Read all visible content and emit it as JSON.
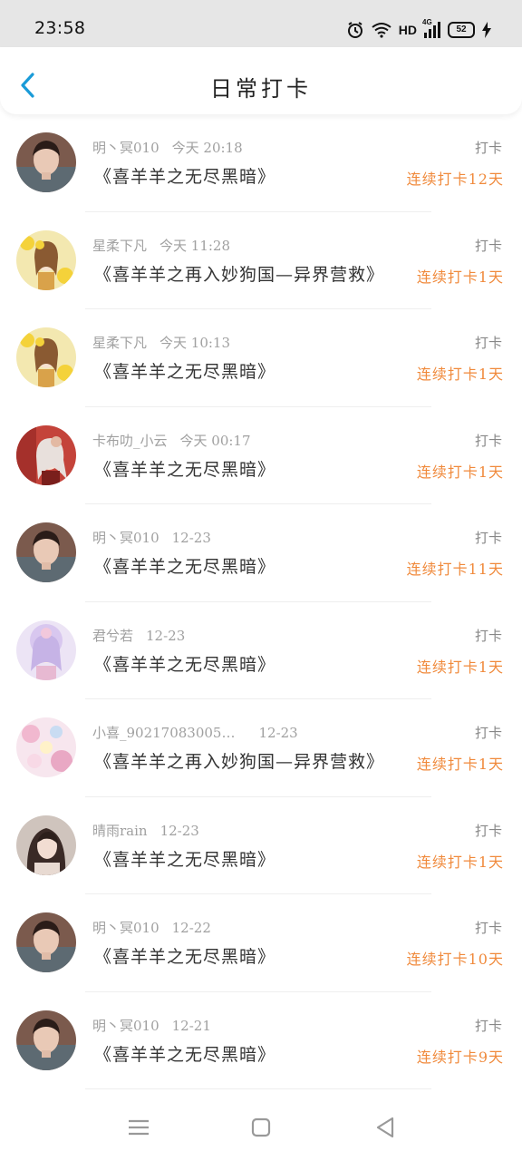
{
  "status_bar": {
    "time": "23:58",
    "network": "HD",
    "signal": "4G",
    "battery": "52"
  },
  "header": {
    "title": "日常打卡"
  },
  "items": [
    {
      "user": "明丶冥010",
      "time": "今天 20:18",
      "book": "《喜羊羊之无尽黑暗》",
      "action": "打卡",
      "streak": "连续打卡12天",
      "avatar": "boy"
    },
    {
      "user": "星柔下凡",
      "time": "今天 11:28",
      "book": "《喜羊羊之再入妙狗国—异界营救》",
      "action": "打卡",
      "streak": "连续打卡1天",
      "avatar": "flower-girl"
    },
    {
      "user": "星柔下凡",
      "time": "今天 10:13",
      "book": "《喜羊羊之无尽黑暗》",
      "action": "打卡",
      "streak": "连续打卡1天",
      "avatar": "flower-girl"
    },
    {
      "user": "卡布叻_小云",
      "time": "今天 00:17",
      "book": "《喜羊羊之无尽黑暗》",
      "action": "打卡",
      "streak": "连续打卡1天",
      "avatar": "anime-red"
    },
    {
      "user": "明丶冥010",
      "time": "12-23",
      "book": "《喜羊羊之无尽黑暗》",
      "action": "打卡",
      "streak": "连续打卡11天",
      "avatar": "boy"
    },
    {
      "user": "君兮若",
      "time": "12-23",
      "book": "《喜羊羊之无尽黑暗》",
      "action": "打卡",
      "streak": "连续打卡1天",
      "avatar": "pastel-girl"
    },
    {
      "user": "小喜_90217083005…",
      "time": "12-23",
      "book": "《喜羊羊之再入妙狗国—异界营救》",
      "action": "打卡",
      "streak": "连续打卡1天",
      "avatar": "pink-flower"
    },
    {
      "user": "晴雨rain",
      "time": "12-23",
      "book": "《喜羊羊之无尽黑暗》",
      "action": "打卡",
      "streak": "连续打卡1天",
      "avatar": "dark-girl"
    },
    {
      "user": "明丶冥010",
      "time": "12-22",
      "book": "《喜羊羊之无尽黑暗》",
      "action": "打卡",
      "streak": "连续打卡10天",
      "avatar": "boy"
    },
    {
      "user": "明丶冥010",
      "time": "12-21",
      "book": "《喜羊羊之无尽黑暗》",
      "action": "打卡",
      "streak": "连续打卡9天",
      "avatar": "boy"
    }
  ],
  "colors": {
    "accent": "#1a9bd8",
    "streak": "#f08a3c",
    "meta": "#a0a0a0"
  }
}
